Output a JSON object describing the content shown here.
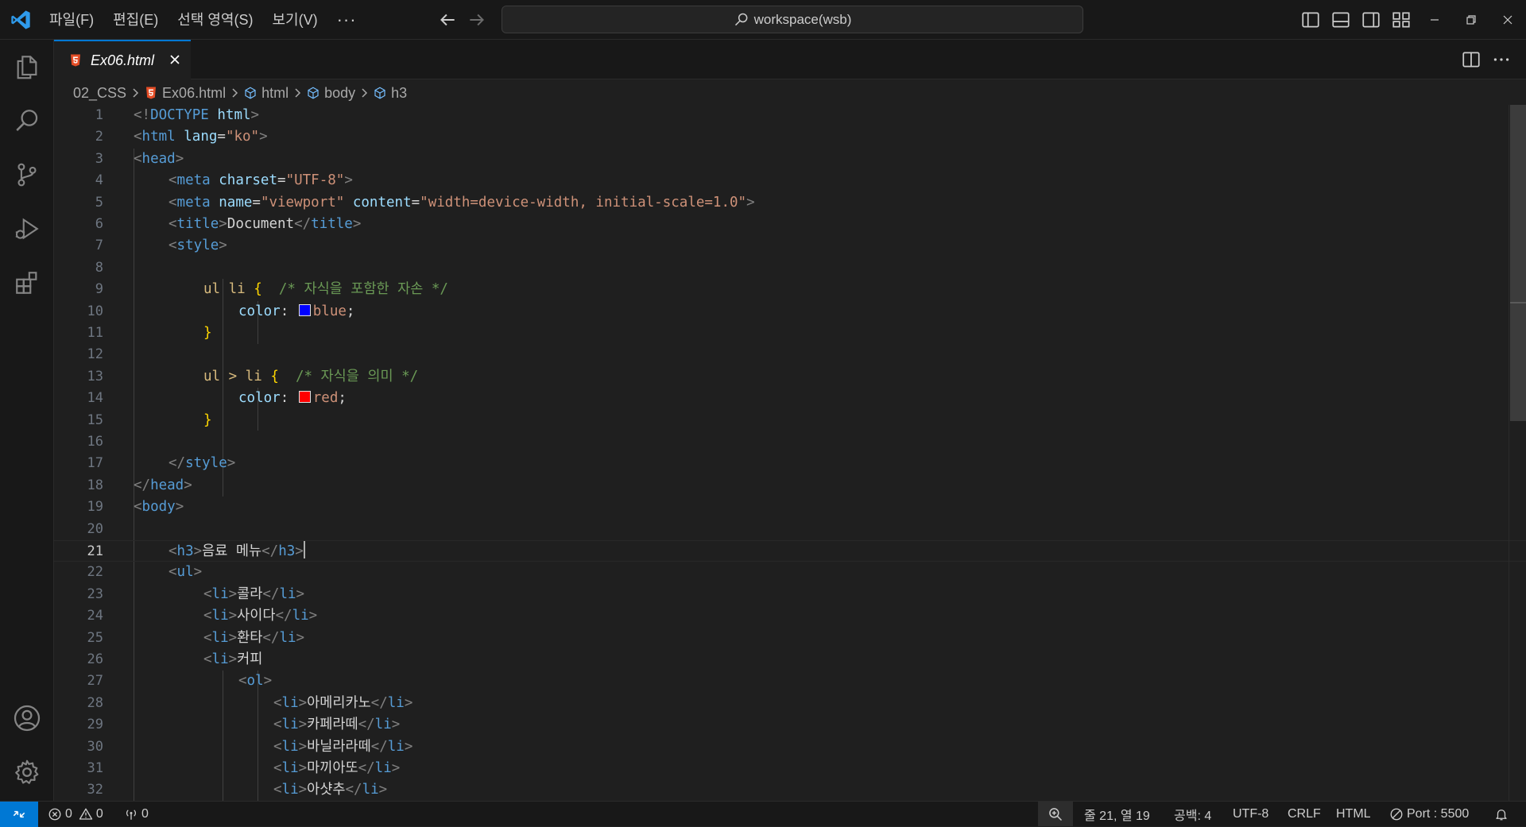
{
  "titlebar": {
    "menu": [
      "파일(F)",
      "편집(E)",
      "선택 영역(S)",
      "보기(V)"
    ],
    "more": "···",
    "search_text": "workspace(wsb)"
  },
  "activity_icons": [
    "explorer-icon",
    "search-icon",
    "source-control-icon",
    "run-debug-icon",
    "extensions-icon",
    "account-icon",
    "settings-gear-icon"
  ],
  "tab": {
    "label": "Ex06.html",
    "icon": "html5-file-icon"
  },
  "breadcrumb": [
    "02_CSS",
    "Ex06.html",
    "html",
    "body",
    "h3"
  ],
  "editor": {
    "current_line": 21,
    "lines": [
      {
        "n": "1"
      },
      {
        "n": "2"
      },
      {
        "n": "3"
      },
      {
        "n": "4"
      },
      {
        "n": "5"
      },
      {
        "n": "6"
      },
      {
        "n": "7"
      },
      {
        "n": "8"
      },
      {
        "n": "9"
      },
      {
        "n": "10"
      },
      {
        "n": "11"
      },
      {
        "n": "12"
      },
      {
        "n": "13"
      },
      {
        "n": "14"
      },
      {
        "n": "15"
      },
      {
        "n": "16"
      },
      {
        "n": "17"
      },
      {
        "n": "18"
      },
      {
        "n": "19"
      },
      {
        "n": "20"
      },
      {
        "n": "21"
      },
      {
        "n": "22"
      },
      {
        "n": "23"
      },
      {
        "n": "24"
      },
      {
        "n": "25"
      },
      {
        "n": "26"
      },
      {
        "n": "27"
      },
      {
        "n": "28"
      },
      {
        "n": "29"
      },
      {
        "n": "30"
      },
      {
        "n": "31"
      },
      {
        "n": "32"
      }
    ],
    "tokens": {
      "l1": [
        "<!",
        "DOCTYPE",
        " ",
        "html",
        ">"
      ],
      "l2": [
        "<",
        "html",
        " ",
        "lang",
        "=",
        "\"ko\"",
        ">"
      ],
      "l3": [
        "<",
        "head",
        ">"
      ],
      "l4": [
        "<",
        "meta",
        " ",
        "charset",
        "=",
        "\"UTF-8\"",
        ">"
      ],
      "l5": [
        "<",
        "meta",
        " ",
        "name",
        "=",
        "\"viewport\"",
        " ",
        "content",
        "=",
        "\"width=device-width, initial-scale=1.0\"",
        ">"
      ],
      "l6": [
        "<",
        "title",
        ">",
        "Document",
        "</",
        "title",
        ">"
      ],
      "l7": [
        "<",
        "style",
        ">"
      ],
      "l9": [
        "ul li",
        " ",
        "{",
        "  ",
        "/* 자식을 포함한 자손 */"
      ],
      "l10": [
        "color",
        ": ",
        "blue",
        ";"
      ],
      "l11": [
        "}"
      ],
      "l13": [
        "ul > li",
        " ",
        "{",
        "  ",
        "/* 자식을 의미 */"
      ],
      "l14": [
        "color",
        ": ",
        "red",
        ";"
      ],
      "l15": [
        "}"
      ],
      "l17": [
        "</",
        "style",
        ">"
      ],
      "l18": [
        "</",
        "head",
        ">"
      ],
      "l19": [
        "<",
        "body",
        ">"
      ],
      "l21": [
        "<",
        "h3",
        ">",
        "음료 메뉴",
        "</",
        "h3",
        ">"
      ],
      "l22": [
        "<",
        "ul",
        ">"
      ],
      "l23": [
        "<",
        "li",
        ">",
        "콜라",
        "</",
        "li",
        ">"
      ],
      "l24": [
        "<",
        "li",
        ">",
        "사이다",
        "</",
        "li",
        ">"
      ],
      "l25": [
        "<",
        "li",
        ">",
        "환타",
        "</",
        "li",
        ">"
      ],
      "l26": [
        "<",
        "li",
        ">",
        "커피"
      ],
      "l27": [
        "<",
        "ol",
        ">"
      ],
      "l28": [
        "<",
        "li",
        ">",
        "아메리카노",
        "</",
        "li",
        ">"
      ],
      "l29": [
        "<",
        "li",
        ">",
        "카페라떼",
        "</",
        "li",
        ">"
      ],
      "l30": [
        "<",
        "li",
        ">",
        "바닐라라떼",
        "</",
        "li",
        ">"
      ],
      "l31": [
        "<",
        "li",
        ">",
        "마끼아또",
        "</",
        "li",
        ">"
      ],
      "l32": [
        "<",
        "li",
        ">",
        "아샷추",
        "</",
        "li",
        ">"
      ]
    },
    "color_swatches": {
      "blue": "#0000ff",
      "red": "#ff0000"
    }
  },
  "statusbar": {
    "errors": "0",
    "warnings": "0",
    "ports": "0",
    "position": "줄 21, 열 19",
    "spaces": "공백: 4",
    "encoding": "UTF-8",
    "eol": "CRLF",
    "language": "HTML",
    "port": "Port : 5500"
  },
  "colors": {
    "accent": "#0078d4",
    "background": "#1f1f1f",
    "chrome": "#181818"
  }
}
